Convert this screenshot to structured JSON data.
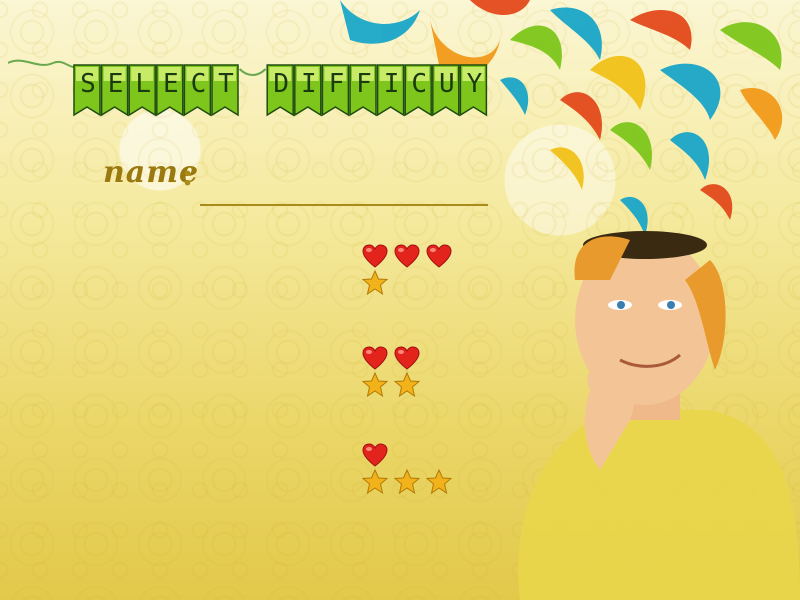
{
  "title": {
    "text": "SELECT DIFFICUY",
    "letters": [
      "S",
      "E",
      "L",
      "E",
      "C",
      "T",
      "",
      "D",
      "I",
      "F",
      "F",
      "I",
      "C",
      "U",
      "Y"
    ]
  },
  "name_field": {
    "label": "name",
    "colon": ":",
    "value": ""
  },
  "difficulty_options": [
    {
      "hearts": 3,
      "stars": 1
    },
    {
      "hearts": 2,
      "stars": 2
    },
    {
      "hearts": 1,
      "stars": 3
    }
  ],
  "colors": {
    "background": "#f5eaa0",
    "banner_green": "#7ec61c",
    "banner_dark": "#1f4d0f",
    "label_gold": "#9a7a10",
    "heart_red": "#e3241c",
    "star_gold": "#f2b21a",
    "shirt_yellow": "#e9d64a",
    "hair_orange": "#e89a2c"
  },
  "icons": [
    "heart-icon",
    "star-icon"
  ]
}
